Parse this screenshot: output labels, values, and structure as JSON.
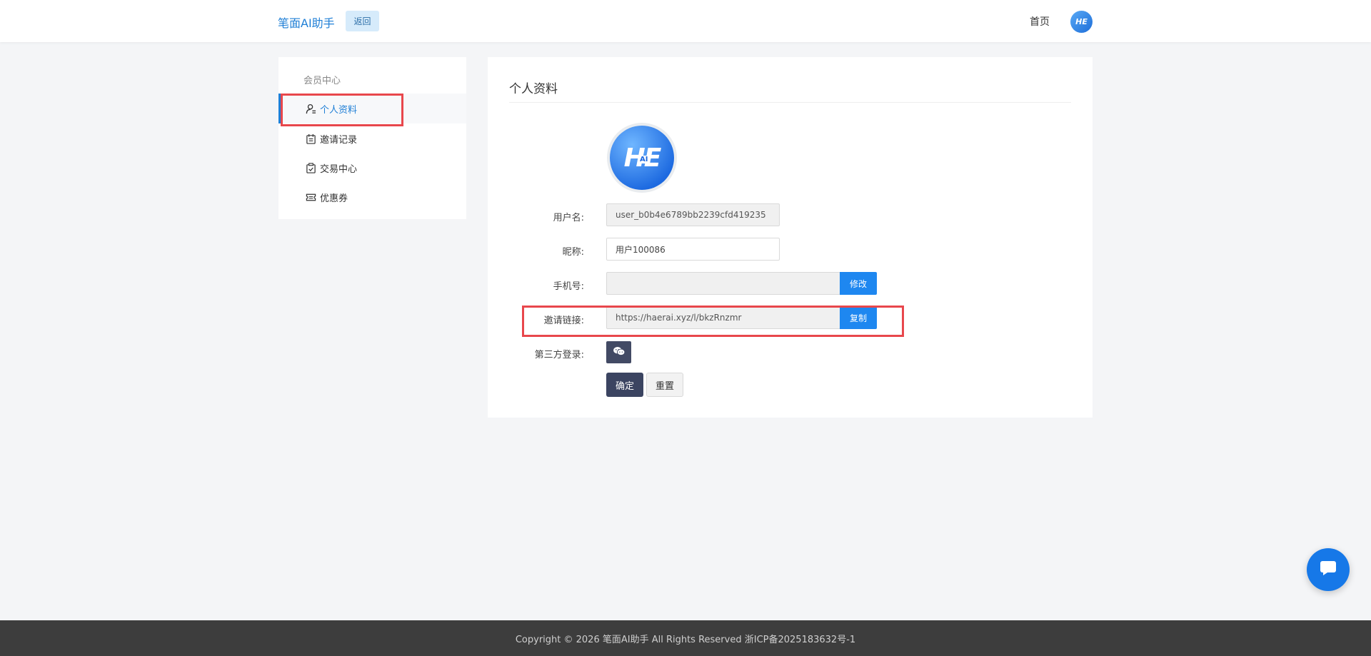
{
  "header": {
    "brand": "笔面AI助手",
    "back_label": "返回",
    "home_label": "首页",
    "avatar_text": "HE"
  },
  "sidebar": {
    "title": "会员中心",
    "items": [
      {
        "label": "个人资料",
        "icon": "user-icon",
        "active": true
      },
      {
        "label": "邀请记录",
        "icon": "calendar-icon",
        "active": false
      },
      {
        "label": "交易中心",
        "icon": "clipboard-check-icon",
        "active": false
      },
      {
        "label": "优惠券",
        "icon": "ticket-icon",
        "active": false
      }
    ]
  },
  "profile": {
    "title": "个人资料",
    "avatar_text": "HE",
    "avatar_sub": "AI",
    "username_label": "用户名:",
    "username_value": "user_b0b4e6789bb2239cfd419235",
    "nickname_label": "昵称:",
    "nickname_value": "用户100086",
    "phone_label": "手机号:",
    "phone_value": "",
    "phone_button": "修改",
    "invite_label": "邀请链接:",
    "invite_value": "https://haerai.xyz/l/bkzRnzmr",
    "invite_button": "复制",
    "third_party_label": "第三方登录:",
    "confirm_label": "确定",
    "reset_label": "重置"
  },
  "footer": {
    "copyright": "Copyright © 2026 笔面AI助手 All Rights Reserved 浙ICP备2025183632号-1"
  },
  "colors": {
    "accent": "#1e87f0",
    "dark_button": "#3b4461",
    "highlight_box": "#e8474c",
    "footer_bg": "#3d3d3d"
  }
}
